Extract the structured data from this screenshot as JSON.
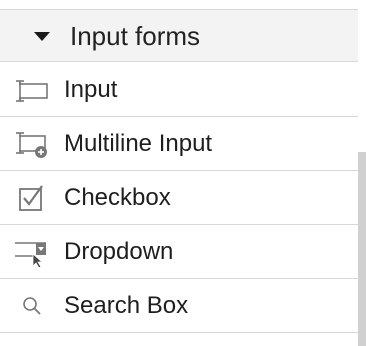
{
  "section": {
    "title": "Input forms",
    "expanded": true
  },
  "items": [
    {
      "label": "Input",
      "icon": "text-input-icon"
    },
    {
      "label": "Multiline Input",
      "icon": "multiline-input-icon"
    },
    {
      "label": "Checkbox",
      "icon": "checkbox-icon"
    },
    {
      "label": "Dropdown",
      "icon": "dropdown-icon"
    },
    {
      "label": "Search Box",
      "icon": "search-icon"
    }
  ],
  "colors": {
    "header_bg": "#f3f3f3",
    "divider": "#d8d8d8",
    "icon": "#777777",
    "text": "#1e1e1e",
    "scrollbar": "#d0d0d0"
  }
}
